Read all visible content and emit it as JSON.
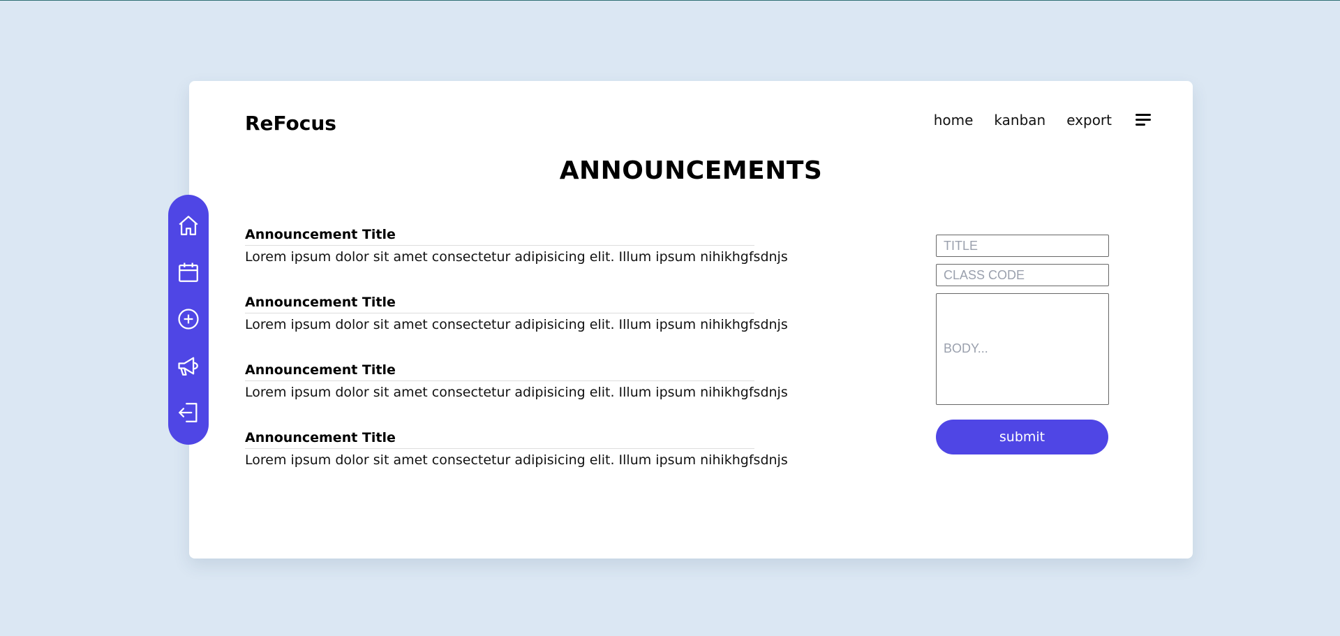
{
  "app": {
    "brand": "ReFocus"
  },
  "nav": {
    "links": [
      {
        "label": "home"
      },
      {
        "label": "kanban"
      },
      {
        "label": "export"
      }
    ],
    "menu_icon": "hamburger-menu-icon"
  },
  "page": {
    "title": "ANNOUNCEMENTS"
  },
  "announcements": [
    {
      "title": "Announcement Title",
      "body": "Lorem ipsum dolor sit amet consectetur adipisicing elit. Illum ipsum nihikhgfsdnjs"
    },
    {
      "title": "Announcement Title",
      "body": "Lorem ipsum dolor sit amet consectetur adipisicing elit. Illum ipsum nihikhgfsdnjs"
    },
    {
      "title": "Announcement Title",
      "body": "Lorem ipsum dolor sit amet consectetur adipisicing elit. Illum ipsum nihikhgfsdnjs"
    },
    {
      "title": "Announcement Title",
      "body": "Lorem ipsum dolor sit amet consectetur adipisicing elit. Illum ipsum nihikhgfsdnjs"
    }
  ],
  "form": {
    "title_placeholder": "TITLE",
    "title_value": "",
    "class_code_placeholder": "CLASS CODE",
    "class_code_value": "",
    "body_placeholder": "BODY...",
    "body_value": "",
    "submit_label": "submit"
  },
  "sidebar": {
    "icons": [
      "home-icon",
      "calendar-icon",
      "plus-circle-icon",
      "megaphone-icon",
      "logout-icon"
    ]
  },
  "colors": {
    "background": "#dbe7f3",
    "card": "#ffffff",
    "accent": "#4f46e5"
  }
}
